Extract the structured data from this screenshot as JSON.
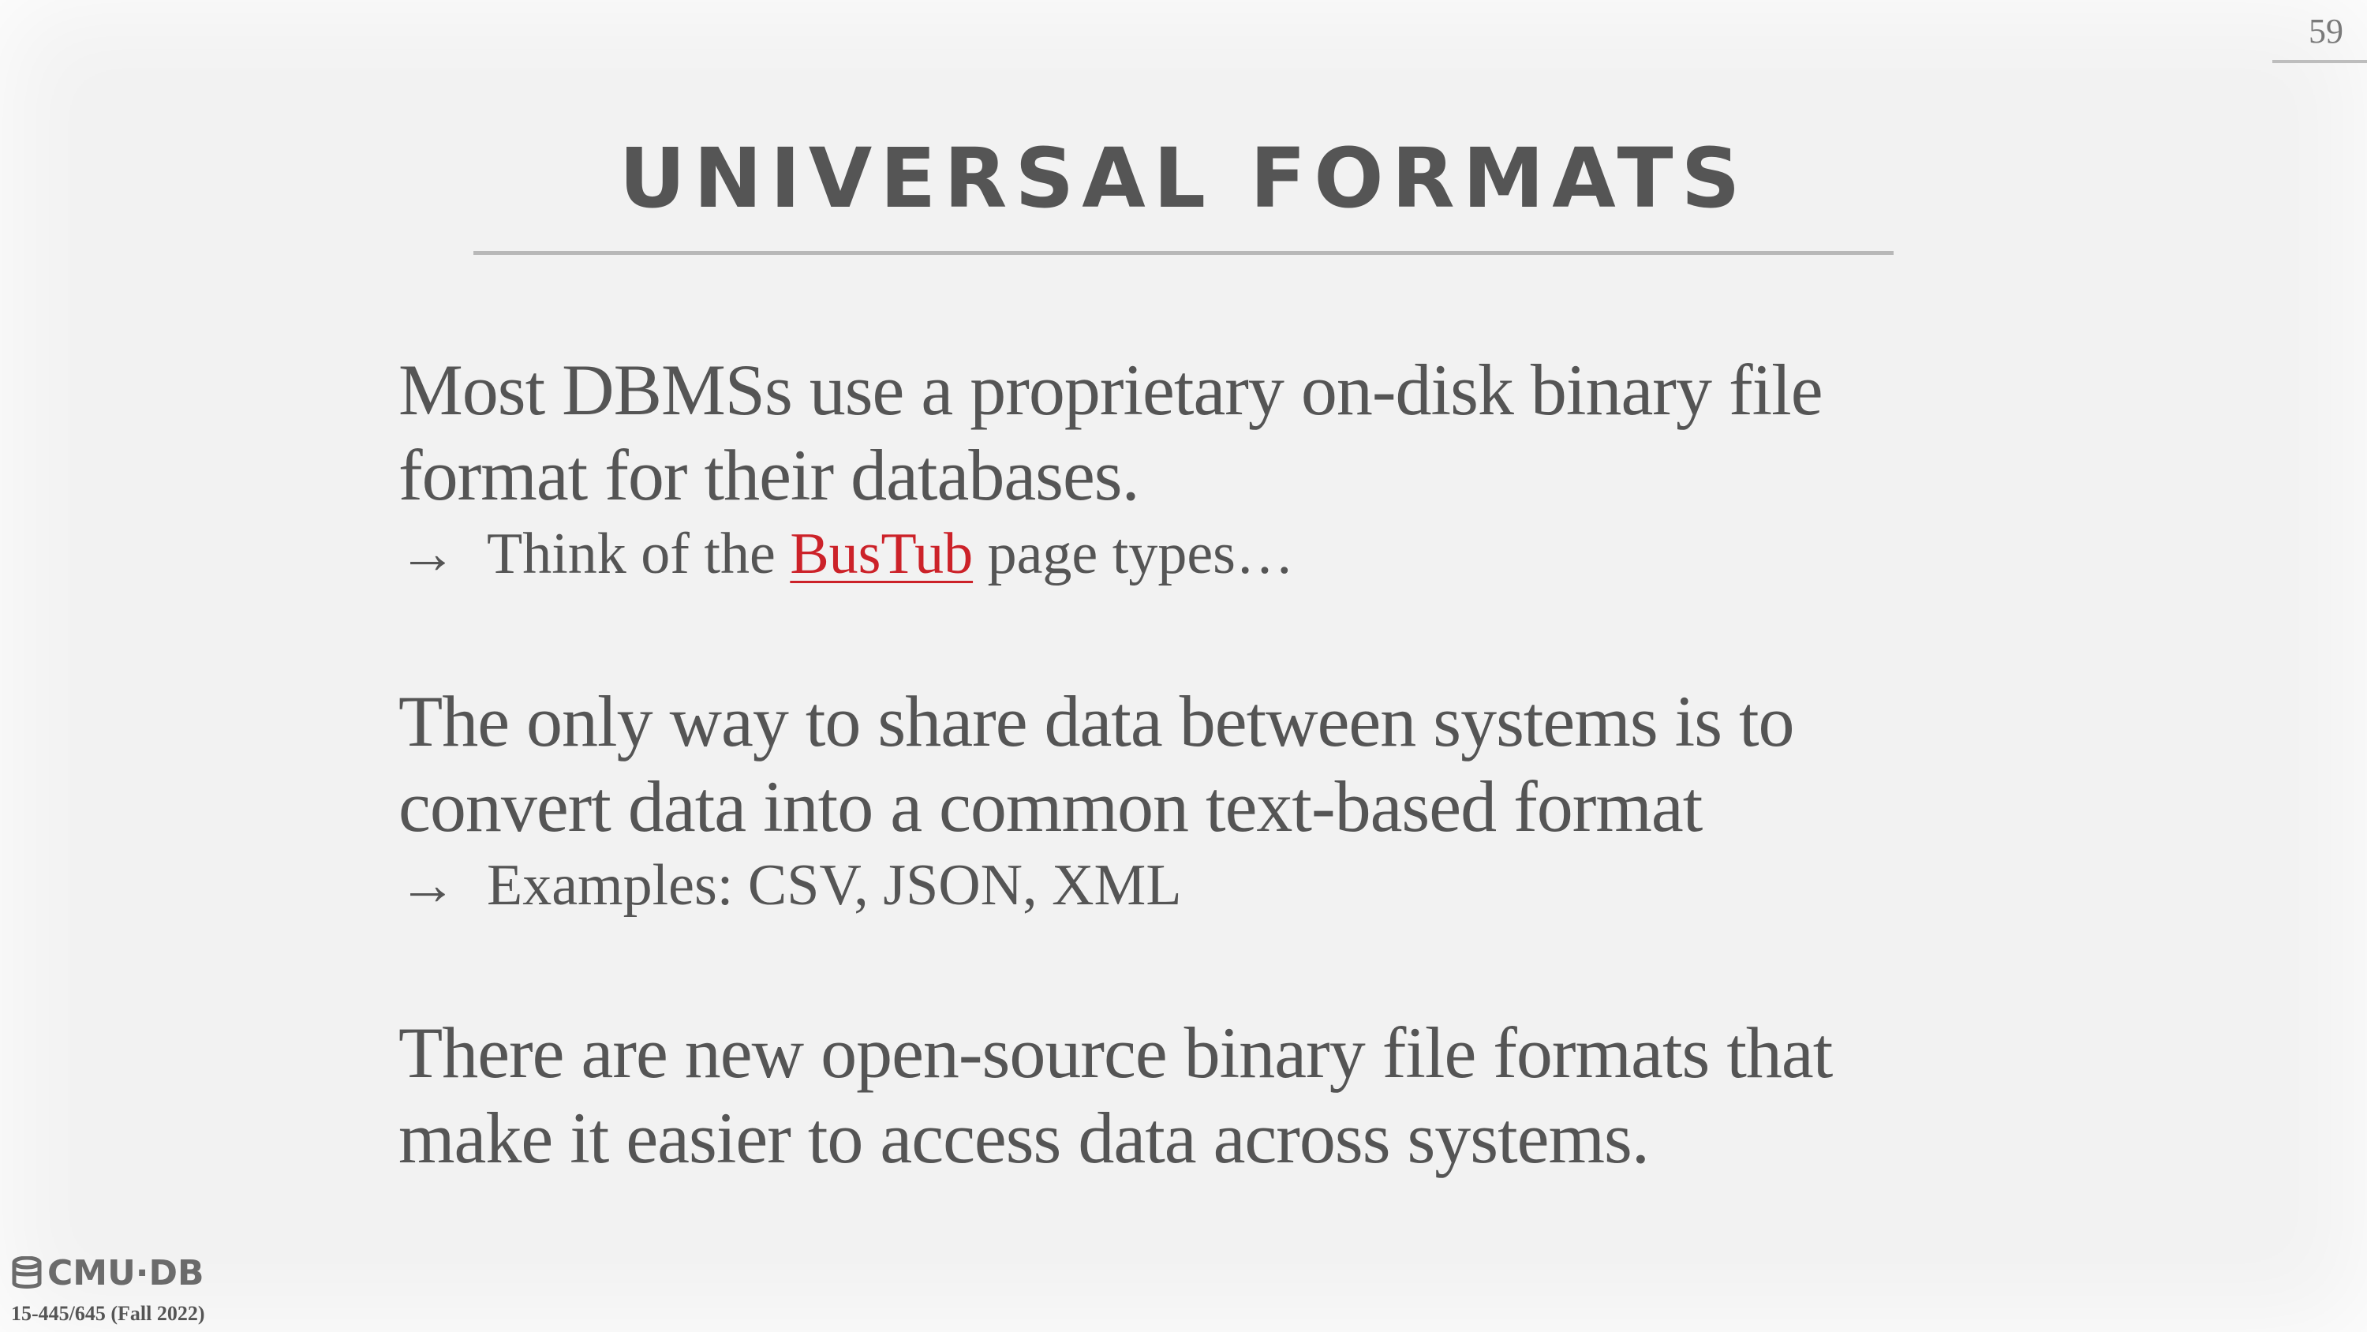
{
  "slide": {
    "page_number": "59",
    "title": "UNIVERSAL FORMATS"
  },
  "content": {
    "block1": {
      "text": "Most DBMSs use a proprietary on-disk binary file format for their databases.",
      "sub": {
        "arrow": "→",
        "prefix": "Think of the ",
        "link": "BusTub",
        "suffix": " page types…"
      }
    },
    "block2": {
      "text": "The only way to share data between systems is to convert data into a common text-based format",
      "sub": {
        "arrow": "→",
        "text": "Examples: CSV, JSON, XML"
      }
    },
    "block3": {
      "text": "There are new open-source binary file formats that make it easier to access data across systems."
    }
  },
  "footer": {
    "logo_text": "CMU·DB",
    "course": "15-445/645 (Fall 2022)"
  },
  "colors": {
    "background": "#f2f2f2",
    "text": "#555555",
    "link": "#cc2229",
    "rule": "#b8b8b8"
  }
}
